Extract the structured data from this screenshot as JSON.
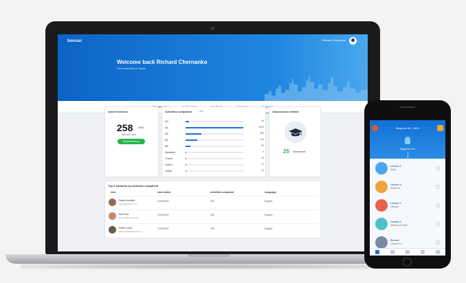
{
  "laptop": {
    "logo": "bonsai",
    "user_name": "Richard Chemanko",
    "welcome_title": "Welcome back Richard Chernanko",
    "welcome_subtitle": "Your institution is Tegus",
    "tabs": [
      {
        "label": "Classrooms",
        "active": false
      },
      {
        "label": "Instructors",
        "active": false
      },
      {
        "label": "Students",
        "active": false
      },
      {
        "label": "Courses",
        "active": false
      },
      {
        "label": "Reports",
        "active": true
      }
    ],
    "active_licenses": {
      "title": "Active licenses",
      "value": "258",
      "of": "/ 300",
      "label": "licenses used",
      "button": "Request licenses"
    },
    "activities": {
      "title": "Activities completed",
      "badge": "(all)",
      "rows": [
        {
          "label": "A0",
          "value": 60,
          "display": "60"
        },
        {
          "label": "A1",
          "value": 1040,
          "display": "1040"
        },
        {
          "label": "A2",
          "value": 280,
          "display": "280"
        },
        {
          "label": "B1",
          "value": 210,
          "display": "210"
        },
        {
          "label": "B2",
          "value": 90,
          "display": "90"
        },
        {
          "label": "Speaker",
          "value": 5,
          "display": "5"
        },
        {
          "label": "Travel",
          "value": 18,
          "display": "18"
        },
        {
          "label": "Listen",
          "value": 14,
          "display": "14"
        },
        {
          "label": "Video",
          "value": 16,
          "display": "16"
        }
      ]
    },
    "classrooms": {
      "title": "Classrooms created",
      "value": "25",
      "label": "Classrooms"
    },
    "top_students": {
      "title": "Top 5 students by activities completed",
      "headers": [
        "User",
        "Last visited",
        "Activities completed",
        "Language"
      ],
      "rows": [
        {
          "name": "Daniel Montilla",
          "email": "daniel@bonsai.com",
          "last": "12/05/2017",
          "count": "320",
          "lang": "English"
        },
        {
          "name": "Ana Ruiz",
          "email": "ana.ruiz@bonsai.com",
          "last": "12/05/2017",
          "count": "305",
          "lang": "English"
        },
        {
          "name": "Pablo Lucas",
          "email": "pablo.lucas@bonsai.com",
          "last": "12/05/2017",
          "count": "298",
          "lang": "English"
        }
      ]
    }
  },
  "phone": {
    "header_title": "Beginner A1 - 86%",
    "level": "Beginner A1",
    "lessons": [
      {
        "name": "Lesson 1",
        "sub": "Hello!",
        "color": "#4aa7ee"
      },
      {
        "name": "Lesson 2",
        "sub": "About me",
        "color": "#f0a23c"
      },
      {
        "name": "Lesson 3",
        "sub": "Let's go!",
        "color": "#e8604a"
      },
      {
        "name": "Lesson 4",
        "sub": "What do you like?",
        "color": "#4fc2c9"
      },
      {
        "name": "Review",
        "sub": "Lessons 1-4",
        "color": "#7a8aa3"
      }
    ]
  }
}
